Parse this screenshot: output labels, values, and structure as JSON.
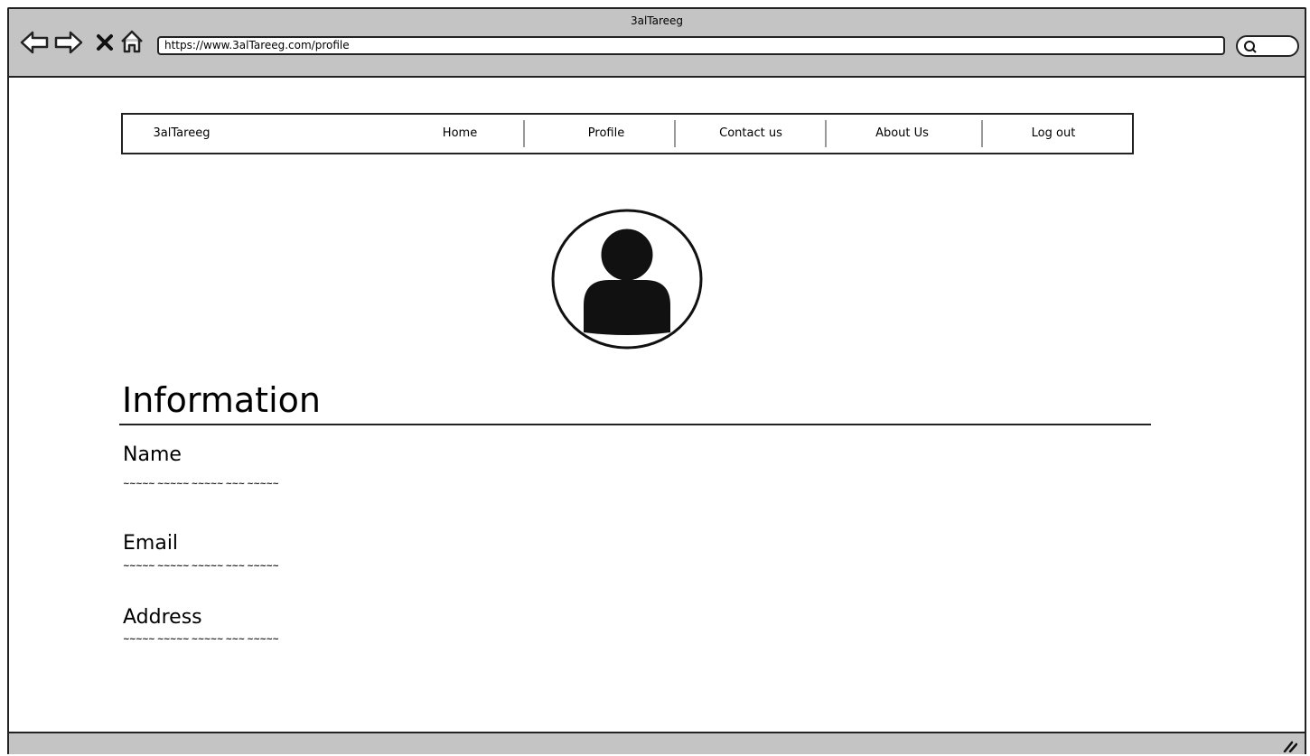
{
  "window": {
    "title": "3alTareeg"
  },
  "browser": {
    "url": "https://www.3alTareeg.com/profile",
    "icons": [
      "back-arrow-icon",
      "forward-arrow-icon",
      "close-icon",
      "home-icon",
      "search-icon"
    ]
  },
  "navbar": {
    "brand": "3alTareeg",
    "items": [
      {
        "label": "Home"
      },
      {
        "label": "Profile"
      },
      {
        "label": "Contact us"
      },
      {
        "label": "About Us"
      },
      {
        "label": "Log out"
      }
    ]
  },
  "profile": {
    "avatar_icon": "user-icon",
    "heading": "Information",
    "fields": [
      {
        "label": "Name",
        "value": "~~~~~ ~~~~~ ~~~~~ ~~~ ~~~~~"
      },
      {
        "label": "Email",
        "value": "~~~~~ ~~~~~ ~~~~~ ~~~ ~~~~~"
      },
      {
        "label": "Address",
        "value": "~~~~~ ~~~~~ ~~~~~ ~~~ ~~~~~"
      }
    ]
  }
}
